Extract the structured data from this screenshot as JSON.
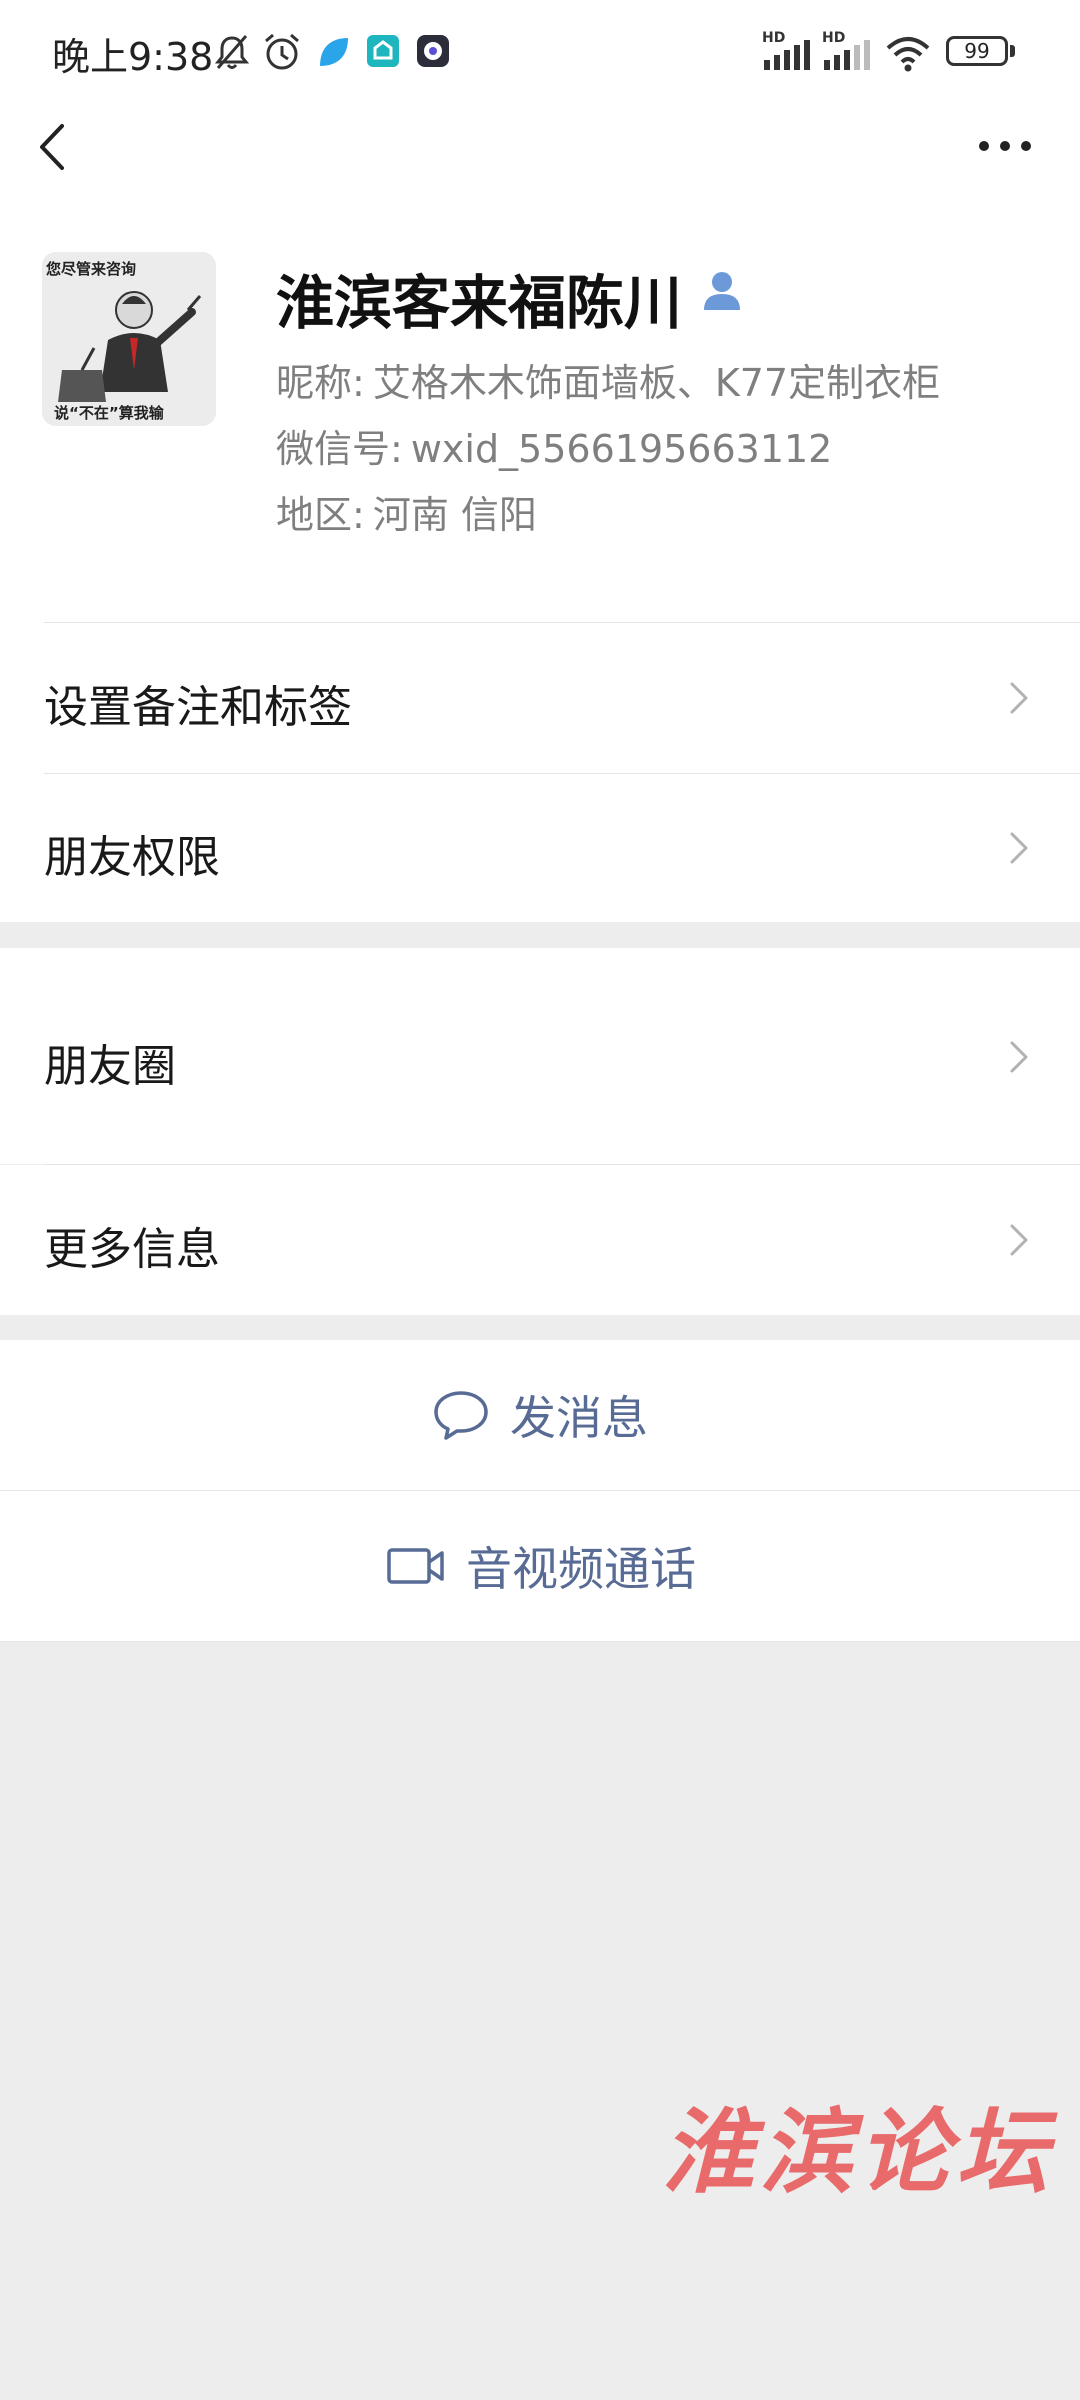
{
  "status_bar": {
    "time": "晚上9:38",
    "signal_1_label": "HD",
    "signal_2_label": "HD",
    "battery": "99",
    "icons": [
      "mute-bell-icon",
      "alarm-icon",
      "app-icon-blue",
      "app-icon-teal",
      "app-icon-dark",
      "signal-icon",
      "wifi-icon",
      "battery-icon"
    ]
  },
  "nav": {
    "back_icon": "chevron-left-icon",
    "more_icon": "more-dots-icon"
  },
  "profile": {
    "avatar_caption_top": "您尽管来咨询",
    "avatar_caption_bottom": "说“不在”算我输",
    "remark_name": "淮滨客来福陈川",
    "contact_icon": "contact-person-icon",
    "nickname_label": "昵称:",
    "nickname": "艾格木木饰面墙板、K77定制衣柜",
    "wechat_id_label": "微信号:",
    "wechat_id": "wxid_5566195663112",
    "region_label": "地区:",
    "region": "河南  信阳"
  },
  "menu": {
    "set_remark": "设置备注和标签",
    "friend_permissions": "朋友权限",
    "moments": "朋友圈",
    "more_info": "更多信息"
  },
  "actions": {
    "send_message": "发消息",
    "av_call": "音视频通话"
  },
  "watermark": "淮滨论坛",
  "colors": {
    "action_blue": "#576b95",
    "background_gray": "#ededed",
    "contact_icon_blue": "#6c9ad8",
    "watermark_red": "#e86a6a"
  }
}
